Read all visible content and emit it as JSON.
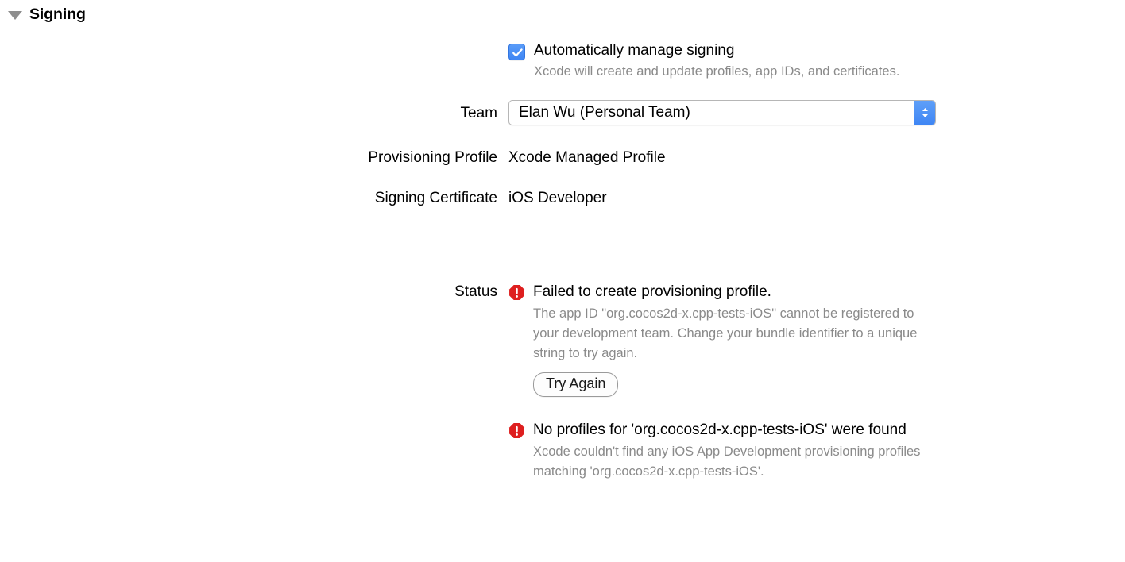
{
  "section": {
    "title": "Signing",
    "disclosure_icon": "triangle-down-icon",
    "expanded": true
  },
  "auto_signing": {
    "checked": true,
    "checkbox_icon": "checkmark-icon",
    "label": "Automatically manage signing",
    "description": "Xcode will create and update profiles, app IDs, and certificates."
  },
  "team": {
    "label": "Team",
    "value": "Elan Wu (Personal Team)",
    "stepper_icon": "chevron-up-down-icon"
  },
  "provisioning_profile": {
    "label": "Provisioning Profile",
    "value": "Xcode Managed Profile"
  },
  "signing_certificate": {
    "label": "Signing Certificate",
    "value": "iOS Developer"
  },
  "status": {
    "label": "Status",
    "items": [
      {
        "icon": "error-octagon-icon",
        "title": "Failed to create provisioning profile.",
        "description": "The app ID \"org.cocos2d-x.cpp-tests-iOS\" cannot be registered to your development team. Change your bundle identifier to a unique string to try again.",
        "action_label": "Try Again"
      },
      {
        "icon": "error-octagon-icon",
        "title": "No profiles for 'org.cocos2d-x.cpp-tests-iOS' were found",
        "description": "Xcode couldn't find any iOS App Development provisioning profiles matching 'org.cocos2d-x.cpp-tests-iOS'."
      }
    ]
  },
  "colors": {
    "accent_blue": "#3f86f4",
    "error_red": "#e02020",
    "secondary_text": "#8a8a8a",
    "divider": "#e6e6e6",
    "background": "#ffffff"
  }
}
